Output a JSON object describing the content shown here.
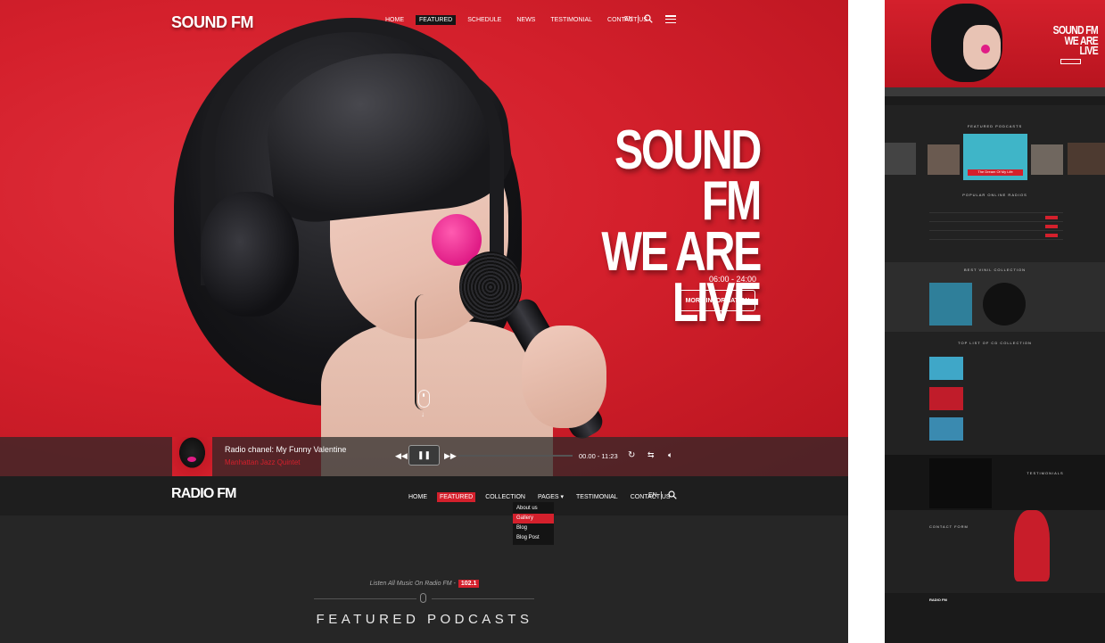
{
  "hero": {
    "logo": "SOUND FM",
    "nav": [
      {
        "label": "HOME",
        "active": false
      },
      {
        "label": "FEATURED",
        "active": true
      },
      {
        "label": "SCHEDULE",
        "active": false
      },
      {
        "label": "NEWS",
        "active": false
      },
      {
        "label": "TESTIMONIAL",
        "active": false
      },
      {
        "label": "CONTACT US",
        "active": false
      }
    ],
    "lang": "EN",
    "title_lines": [
      "SOUND FM",
      "WE ARE",
      "LIVE"
    ],
    "time": "06:00 - 24:00",
    "cta": "MORE INFORMATION"
  },
  "player": {
    "title": "Radio chanel: My Funny Valentine",
    "artist": "Manhattan Jazz Quintet",
    "time": "00.00 - 11:23",
    "progress_fraction": 0.0
  },
  "nav2": {
    "logo": "RADIO FM",
    "items": [
      {
        "label": "HOME",
        "active": false
      },
      {
        "label": "FEATURED",
        "active": true
      },
      {
        "label": "COLLECTION",
        "active": false
      },
      {
        "label": "PAGES",
        "active": false
      },
      {
        "label": "TESTIMONIAL",
        "active": false
      },
      {
        "label": "CONTACT US",
        "active": false
      }
    ],
    "lang": "EN",
    "dropdown": [
      {
        "label": "About us",
        "active": false
      },
      {
        "label": "Gallery",
        "active": true
      },
      {
        "label": "Blog",
        "active": false
      },
      {
        "label": "Blog Post",
        "active": false
      }
    ]
  },
  "featured": {
    "tagline": "Listen All Music On Radio FM -",
    "frequency": "102.1",
    "title": "FEATURED PODCASTS"
  },
  "preview": {
    "hero_title_lines": [
      "SOUND FM",
      "WE ARE",
      "LIVE"
    ],
    "nav_logo": "RADIO FM",
    "sections": [
      "FEATURED PODCASTS",
      "POPULAR ONLINE RADIOS",
      "BEST VINIL COLLECTION",
      "TOP LIST OF CD COLLECTION",
      "TESTIMONIALS",
      "CONTACT FORM"
    ],
    "card_caption": "The Dream Of My Life"
  },
  "colors": {
    "accent": "#d4202c",
    "dark": "#262626",
    "nav_dark": "#1e1e1e"
  }
}
